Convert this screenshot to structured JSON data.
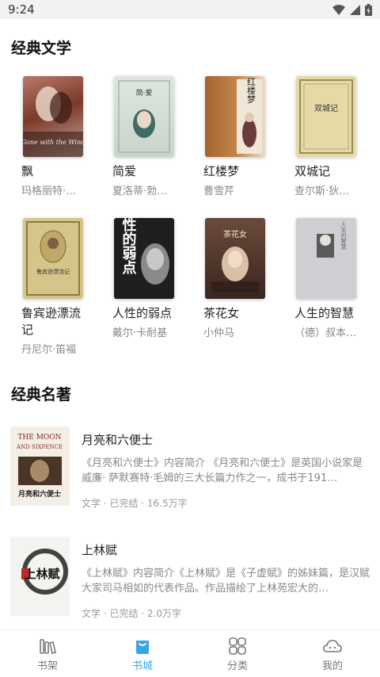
{
  "status_bar": {
    "time": "9:24"
  },
  "sections": {
    "classic_literature": {
      "title": "经典文学",
      "books": [
        {
          "title": "飘",
          "author": "玛格丽特·…"
        },
        {
          "title": "简爱",
          "author": "夏洛蒂·勃…"
        },
        {
          "title": "红楼梦",
          "author": "曹雪芹"
        },
        {
          "title": "双城记",
          "author": "查尔斯·狄…"
        },
        {
          "title": "鲁宾逊漂流记",
          "author": "丹尼尔·笛福"
        },
        {
          "title": "人性的弱点",
          "author": "戴尔·卡耐基"
        },
        {
          "title": "茶花女",
          "author": "小仲马"
        },
        {
          "title": "人生的智慧",
          "author": "（德）叔本…"
        }
      ]
    },
    "classic_masterpieces": {
      "title": "经典名著",
      "items": [
        {
          "title": "月亮和六便士",
          "desc": "《月亮和六便士》内容简介 《月亮和六便士》是英国小说家是威廉· 萨默赛特·毛姆的三大长篇力作之一，成书于191…",
          "meta": "文学 · 已完结 · 16.5万字"
        },
        {
          "title": "上林赋",
          "desc": "《上林赋》内容简介《上林赋》是《子虚赋》的姊妹篇，是汉赋大家司马相如的代表作品。作品描绘了上林苑宏大的…",
          "meta": "文学 · 已完结 · 2.0万字"
        }
      ]
    }
  },
  "cover_text": {
    "moon_line1": "THE MOON",
    "moon_line2": "AND SIXPENCE",
    "moon_cn": "月亮和六便士",
    "shanglin": "上林赋",
    "hongloumeng": "红楼梦",
    "shuangchengji": "双城记",
    "renxing": "人性的弱点",
    "lubinxun": "鲁宾逊漂流记",
    "chahua": "茶花女",
    "rensheng": "人生的智慧",
    "jianai": "简·爱",
    "gone": "Gone with the Wind"
  },
  "tab_bar": {
    "tabs": [
      {
        "label": "书架",
        "icon": "bookshelf-icon"
      },
      {
        "label": "书城",
        "icon": "bookstore-icon"
      },
      {
        "label": "分类",
        "icon": "category-icon"
      },
      {
        "label": "我的",
        "icon": "profile-icon"
      }
    ],
    "active_color": "#3aa6e6"
  }
}
